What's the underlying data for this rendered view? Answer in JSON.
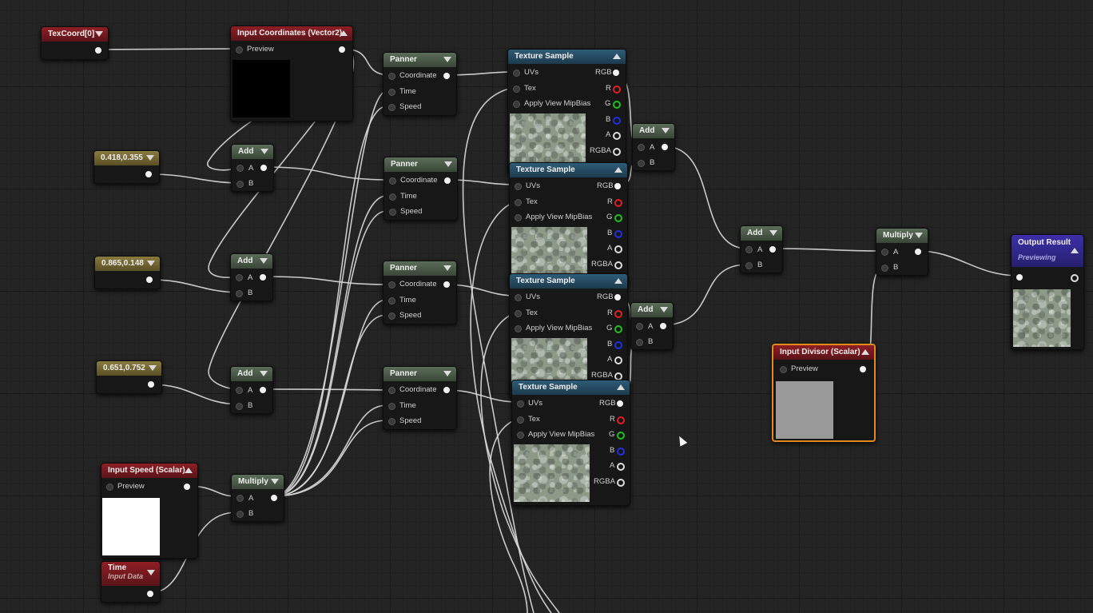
{
  "nodes": {
    "texcoord": {
      "title": "TexCoord[0]"
    },
    "input_coords": {
      "title": "Input Coordinates (Vector2)",
      "preview_label": "Preview"
    },
    "const1": {
      "title": "0.418,0.355"
    },
    "const2": {
      "title": "0.865,0.148"
    },
    "const3": {
      "title": "0.651,0.752"
    },
    "input_speed": {
      "title": "Input Speed (Scalar)",
      "preview_label": "Preview"
    },
    "time": {
      "title": "Time",
      "subtitle": "Input Data"
    },
    "add1": {
      "title": "Add",
      "pin_a": "A",
      "pin_b": "B"
    },
    "add2": {
      "title": "Add",
      "pin_a": "A",
      "pin_b": "B"
    },
    "add3": {
      "title": "Add",
      "pin_a": "A",
      "pin_b": "B"
    },
    "multiply_speed": {
      "title": "Multiply",
      "pin_a": "A",
      "pin_b": "B"
    },
    "panner1": {
      "title": "Panner",
      "coordinate": "Coordinate",
      "time": "Time",
      "speed": "Speed"
    },
    "panner2": {
      "title": "Panner",
      "coordinate": "Coordinate",
      "time": "Time",
      "speed": "Speed"
    },
    "panner3": {
      "title": "Panner",
      "coordinate": "Coordinate",
      "time": "Time",
      "speed": "Speed"
    },
    "panner4": {
      "title": "Panner",
      "coordinate": "Coordinate",
      "time": "Time",
      "speed": "Speed"
    },
    "texsample1": {
      "title": "Texture Sample",
      "uvs": "UVs",
      "tex": "Tex",
      "mip": "Apply View MipBias",
      "rgb": "RGB",
      "r": "R",
      "g": "G",
      "b": "B",
      "a": "A",
      "rgba": "RGBA"
    },
    "texsample2": {
      "title": "Texture Sample",
      "uvs": "UVs",
      "tex": "Tex",
      "mip": "Apply View MipBias",
      "rgb": "RGB",
      "r": "R",
      "g": "G",
      "b": "B",
      "a": "A",
      "rgba": "RGBA"
    },
    "texsample3": {
      "title": "Texture Sample",
      "uvs": "UVs",
      "tex": "Tex",
      "mip": "Apply View MipBias",
      "rgb": "RGB",
      "r": "R",
      "g": "G",
      "b": "B",
      "a": "A",
      "rgba": "RGBA"
    },
    "texsample4": {
      "title": "Texture Sample",
      "uvs": "UVs",
      "tex": "Tex",
      "mip": "Apply View MipBias",
      "rgb": "RGB",
      "r": "R",
      "g": "G",
      "b": "B",
      "a": "A",
      "rgba": "RGBA"
    },
    "add_ts12": {
      "title": "Add",
      "pin_a": "A",
      "pin_b": "B"
    },
    "add_ts34": {
      "title": "Add",
      "pin_a": "A",
      "pin_b": "B"
    },
    "add_final": {
      "title": "Add",
      "pin_a": "A",
      "pin_b": "B"
    },
    "multiply_final": {
      "title": "Multiply",
      "pin_a": "A",
      "pin_b": "B"
    },
    "input_divisor": {
      "title": "Input Divisor (Scalar)",
      "preview_label": "Preview"
    },
    "output": {
      "title": "Output Result",
      "subtitle": "Previewing"
    }
  },
  "colors": {
    "channel_r": "#e02020",
    "channel_g": "#20c020",
    "channel_b": "#2030e0",
    "selection": "#e08a1c",
    "graph_bg": "#242424"
  }
}
